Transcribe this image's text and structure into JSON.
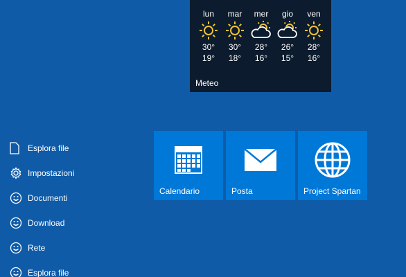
{
  "weather": {
    "label": "Meteo",
    "forecast": [
      {
        "day": "lun",
        "icon": "sun-icon",
        "high": "30°",
        "low": "19°"
      },
      {
        "day": "mar",
        "icon": "sun-icon",
        "high": "30°",
        "low": "18°"
      },
      {
        "day": "mer",
        "icon": "partly-cloudy-icon",
        "high": "28°",
        "low": "16°"
      },
      {
        "day": "gio",
        "icon": "partly-cloudy-icon",
        "high": "26°",
        "low": "15°"
      },
      {
        "day": "ven",
        "icon": "sun-icon",
        "high": "28°",
        "low": "16°"
      }
    ]
  },
  "places": [
    {
      "label": "Esplora file",
      "icon": "file-icon"
    },
    {
      "label": "Impostazioni",
      "icon": "gear-icon"
    },
    {
      "label": "Documenti",
      "icon": "smiley-icon"
    },
    {
      "label": "Download",
      "icon": "smiley-icon"
    },
    {
      "label": "Rete",
      "icon": "smiley-icon"
    },
    {
      "label": "Esplora file",
      "icon": "smiley-icon"
    }
  ],
  "tiles": [
    {
      "label": "Calendario",
      "icon": "calendar-icon"
    },
    {
      "label": "Posta",
      "icon": "mail-icon"
    },
    {
      "label": "Project Spartan",
      "icon": "globe-icon"
    }
  ],
  "colors": {
    "background": "#0f5ba8",
    "tile": "#0078d7",
    "weather_tile": "#0c1b2d",
    "sun": "#f2c230"
  }
}
